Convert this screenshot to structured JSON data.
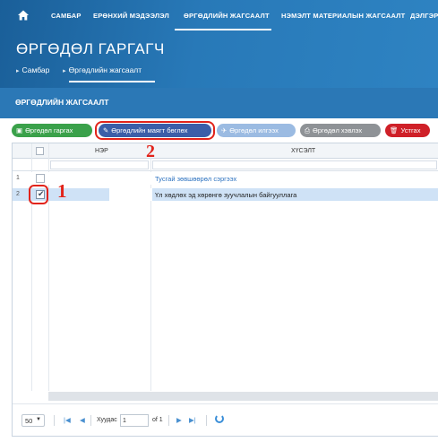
{
  "nav": {
    "items": [
      {
        "label": "САМБАР"
      },
      {
        "label": "ЕРӨНХИЙ МЭДЭЭЛЭЛ"
      },
      {
        "label": "ӨРГӨДЛИЙН ЖАГСААЛТ",
        "active": true
      },
      {
        "label": "НЭМЭЛТ МАТЕРИАЛЫН ЖАГСААЛТ"
      },
      {
        "label": "ДЭЛГЭР"
      }
    ]
  },
  "app": {
    "title": "ӨРГӨДӨЛ ГАРГАГЧ"
  },
  "breadcrumb": {
    "home": "Самбар",
    "current": "Өргөдлийн жагсаалт"
  },
  "section": {
    "title": "ӨРГӨДЛИЙН ЖАГСААЛТ"
  },
  "toolbar": {
    "submit_label": "Өргөдөл гаргах",
    "fill_form_label": "Өргөдлийн маягт бөглөх",
    "sign_label": "Өргөдөл илгээх",
    "print_label": "Өргөдөл хэвлэх",
    "delete_label": "Устгах"
  },
  "grid": {
    "columns": [
      "НЭР",
      "ХҮСЭЛТ"
    ],
    "rows": [
      {
        "num": "1",
        "checked": false,
        "request": "Тусгай зөвшөөрөл сэргээх"
      },
      {
        "num": "2",
        "checked": true,
        "request": "Үл хөдлөх эд хөрөнгө зуучлалын байгууллага"
      }
    ]
  },
  "pager": {
    "page_size": "50",
    "page_label": "Хуудас",
    "page_value": "1",
    "of_label": "of 1"
  },
  "annotations": {
    "marker_1": "1",
    "marker_2": "2"
  },
  "colors": {
    "header": "#2879b8",
    "accent_red": "#e2231a",
    "btn_green": "#3aa14a",
    "btn_blue": "#3b5ea8",
    "btn_red": "#cf2028",
    "selected_row": "#cfe2f6"
  }
}
